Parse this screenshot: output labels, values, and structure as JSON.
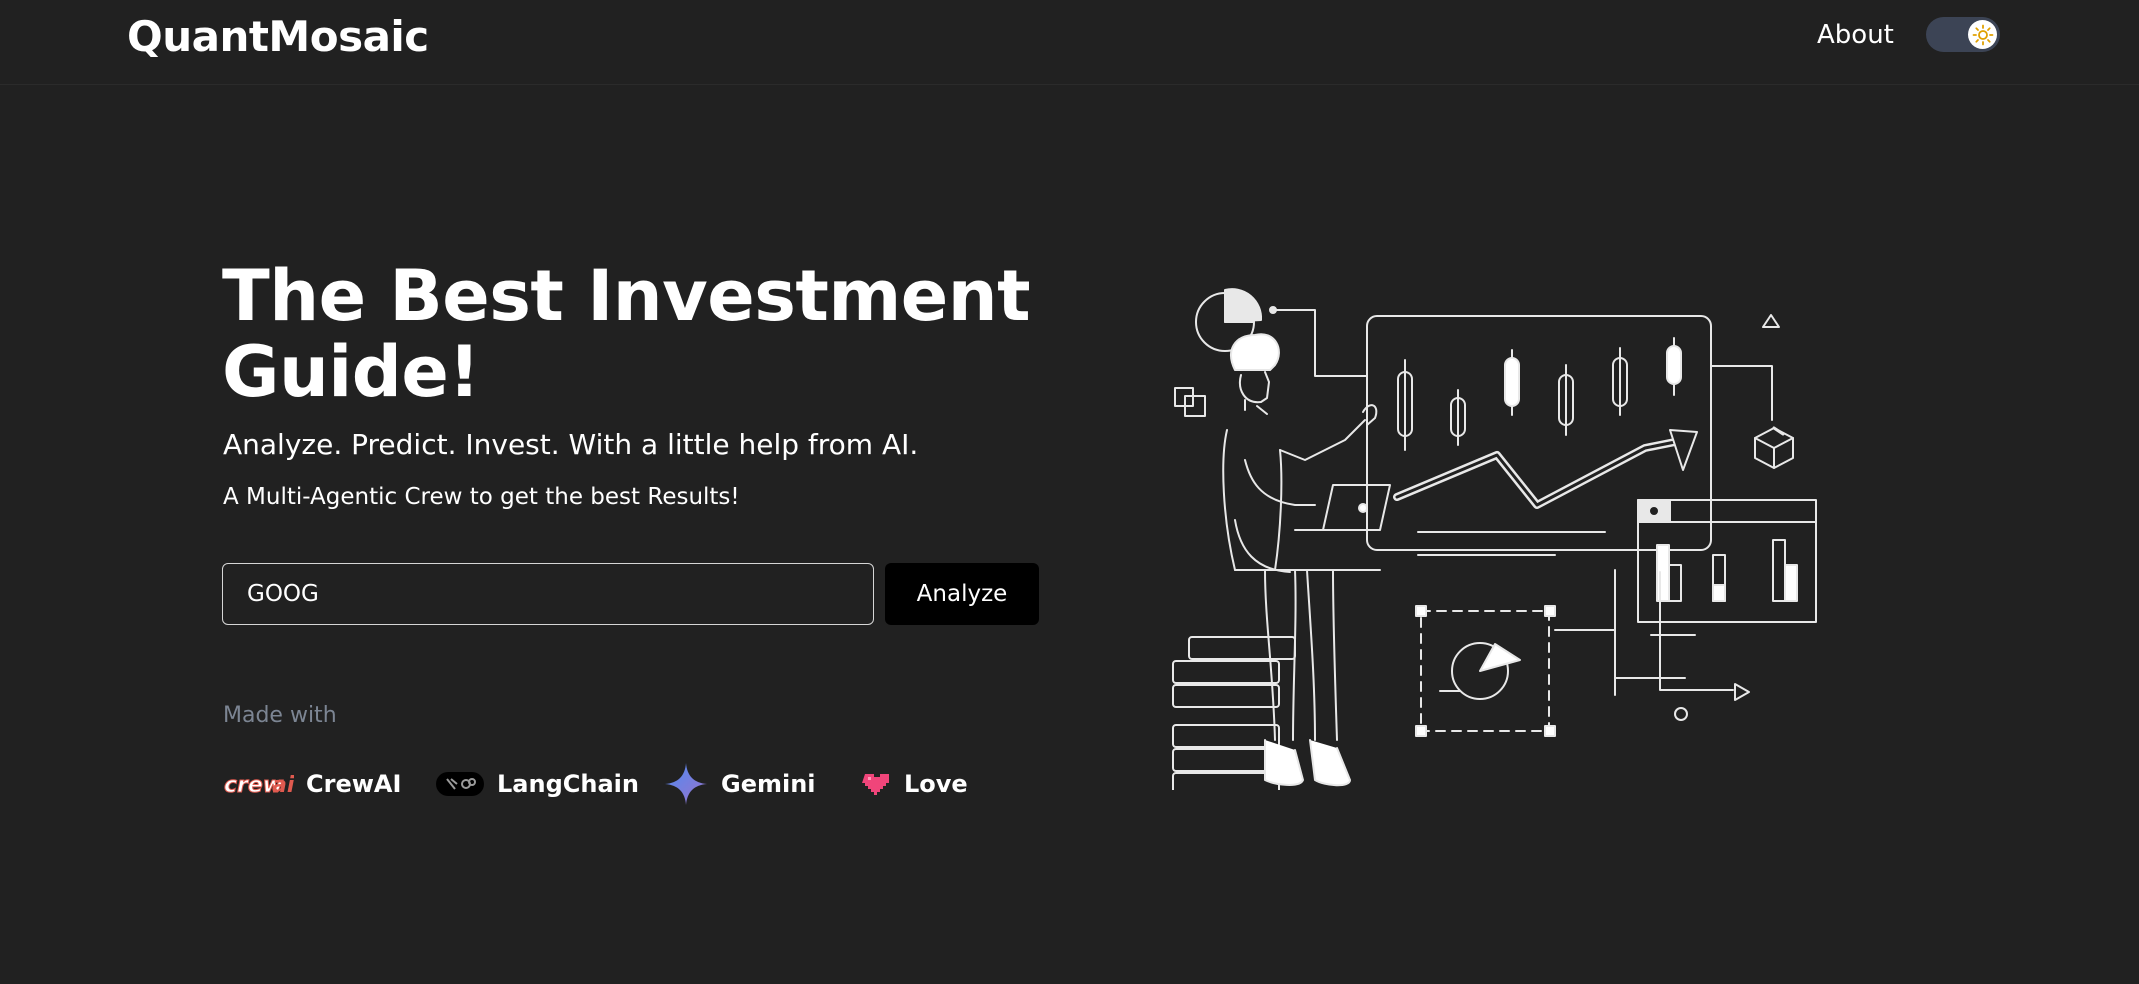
{
  "header": {
    "brand": "QuantMosaic",
    "nav": {
      "about_label": "About"
    },
    "theme_toggle": {
      "state": "light-mode-icon"
    }
  },
  "hero": {
    "title": "The Best Investment Guide!",
    "subtitle": "Analyze. Predict. Invest. With a little help from AI.",
    "tagline": "A Multi-Agentic Crew to get the best Results!",
    "ticker_input": {
      "value": "GOOG",
      "placeholder": ""
    },
    "analyze_label": "Analyze"
  },
  "credits": {
    "heading": "Made with",
    "items": [
      {
        "label": "CrewAI",
        "icon": "crewai-logo-icon",
        "logo_text": "crewai"
      },
      {
        "label": "LangChain",
        "icon": "langchain-logo-icon"
      },
      {
        "label": "Gemini",
        "icon": "gemini-star-icon"
      },
      {
        "label": "Love",
        "icon": "pixel-heart-icon"
      }
    ]
  },
  "colors": {
    "background": "#212121",
    "text": "#ffffff",
    "muted": "#7c8593",
    "button": "#000000",
    "toggle_track": "#3c4455",
    "crewai_accent": "#e05a4f",
    "gemini_blue": "#4e8cf3",
    "heart": "#f0457a"
  },
  "illustration": {
    "name": "investment-analytics-illustration"
  }
}
